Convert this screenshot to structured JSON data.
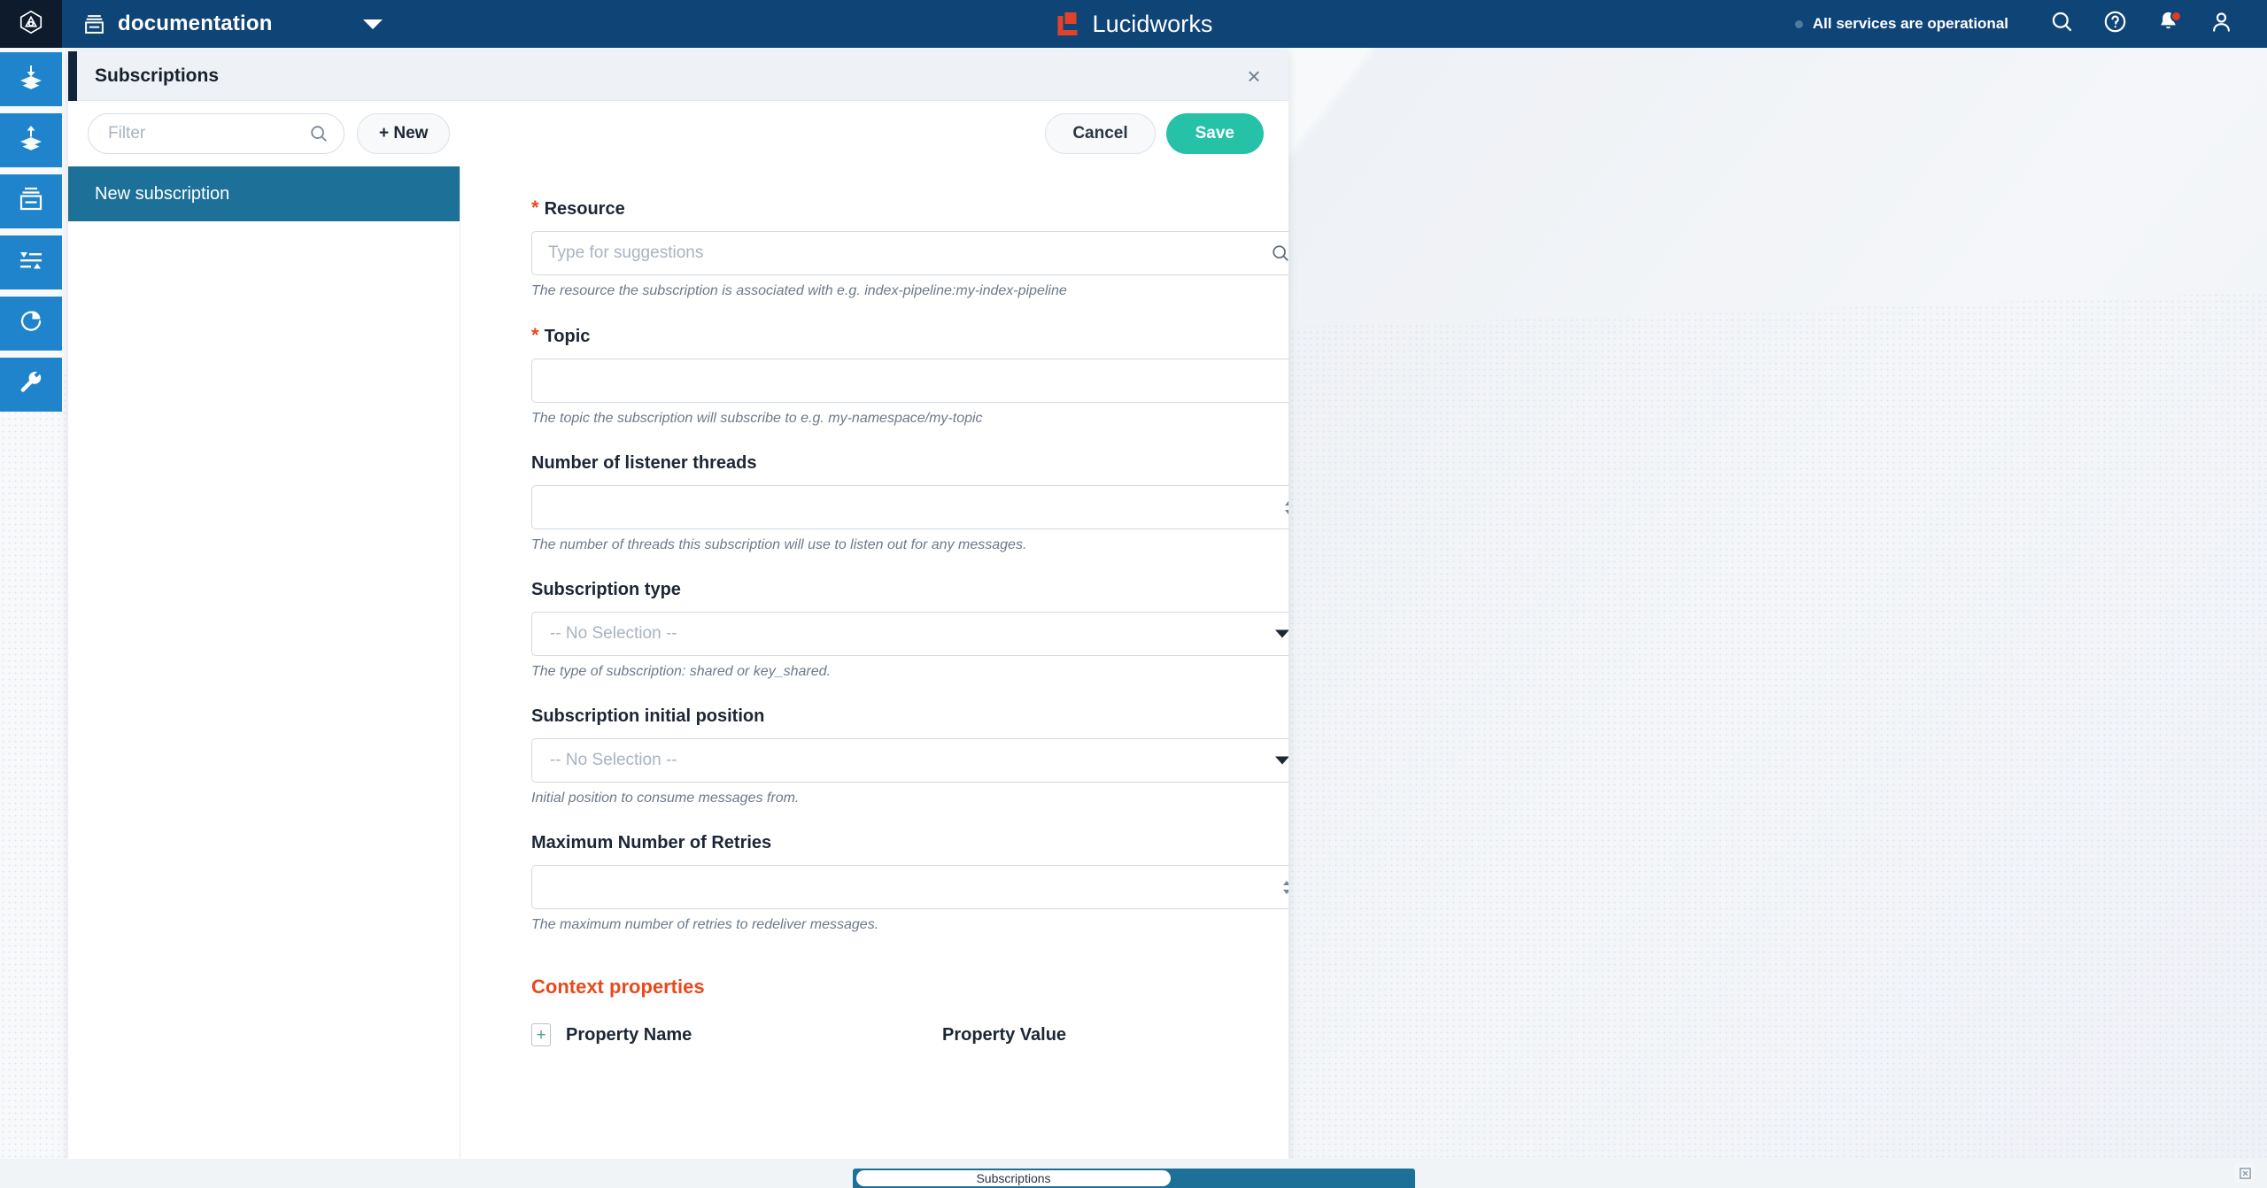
{
  "topbar": {
    "logo_icon": "fusion-hexagon-logo-icon",
    "app_switcher": {
      "icon": "collection-box-icon",
      "name": "documentation",
      "caret_icon": "chevron-down-icon"
    },
    "brand": {
      "mark_icon": "lucidworks-mark-icon",
      "name": "Lucidworks"
    },
    "status": {
      "text": "All services are operational",
      "dot_color": "#4e7c9b"
    },
    "actions": [
      {
        "name": "search-icon",
        "label": "Search"
      },
      {
        "name": "help-icon",
        "label": "Help"
      },
      {
        "name": "notifications-bell-icon",
        "label": "Notifications",
        "has_badge": true
      },
      {
        "name": "user-account-icon",
        "label": "Account"
      }
    ]
  },
  "rail": {
    "items": [
      {
        "name": "indexing-icon",
        "label": "Indexing"
      },
      {
        "name": "querying-icon",
        "label": "Querying"
      },
      {
        "name": "collections-icon",
        "label": "Collections"
      },
      {
        "name": "relevance-icon",
        "label": "Relevance"
      },
      {
        "name": "analytics-icon",
        "label": "Analytics"
      },
      {
        "name": "system-tools-icon",
        "label": "System"
      }
    ]
  },
  "panel": {
    "title": "Subscriptions",
    "close_label": "×",
    "toolbar": {
      "filter_placeholder": "Filter",
      "filter_value": "",
      "filter_icon": "search-icon",
      "new_label": "+ New",
      "cancel_label": "Cancel",
      "save_label": "Save",
      "save_color": "#25c2a8"
    },
    "list": {
      "items": [
        {
          "label": "New subscription",
          "selected": true
        }
      ]
    },
    "form": {
      "fields": [
        {
          "label": "Resource",
          "required": true,
          "required_mark": "*",
          "type": "autocomplete",
          "value": "",
          "placeholder": "Type for suggestions",
          "icon": "search-icon",
          "help": "The resource the subscription is associated with e.g. index-pipeline:my-index-pipeline"
        },
        {
          "label": "Topic",
          "required": true,
          "required_mark": "*",
          "type": "text",
          "value": "",
          "placeholder": "",
          "help": "The topic the subscription will subscribe to e.g. my-namespace/my-topic"
        },
        {
          "label": "Number of listener threads",
          "required": false,
          "type": "number",
          "value": "",
          "placeholder": "",
          "help": "The number of threads this subscription will use to listen out for any messages."
        },
        {
          "label": "Subscription type",
          "required": false,
          "type": "select",
          "value": "-- No Selection --",
          "help": "The type of subscription: shared or key_shared."
        },
        {
          "label": "Subscription initial position",
          "required": false,
          "type": "select",
          "value": "-- No Selection --",
          "help": "Initial position to consume messages from."
        },
        {
          "label": "Maximum Number of Retries",
          "required": false,
          "type": "number",
          "value": "",
          "placeholder": "",
          "help": "The maximum number of retries to redeliver messages."
        }
      ],
      "context_properties": {
        "title": "Context properties",
        "title_color": "#e8491d",
        "add_label": "+",
        "columns": [
          "Property Name",
          "Property Value"
        ],
        "rows": []
      }
    }
  },
  "taskbar": {
    "tab_label": "Subscriptions",
    "corner_icon": "show-desktop-icon"
  }
}
